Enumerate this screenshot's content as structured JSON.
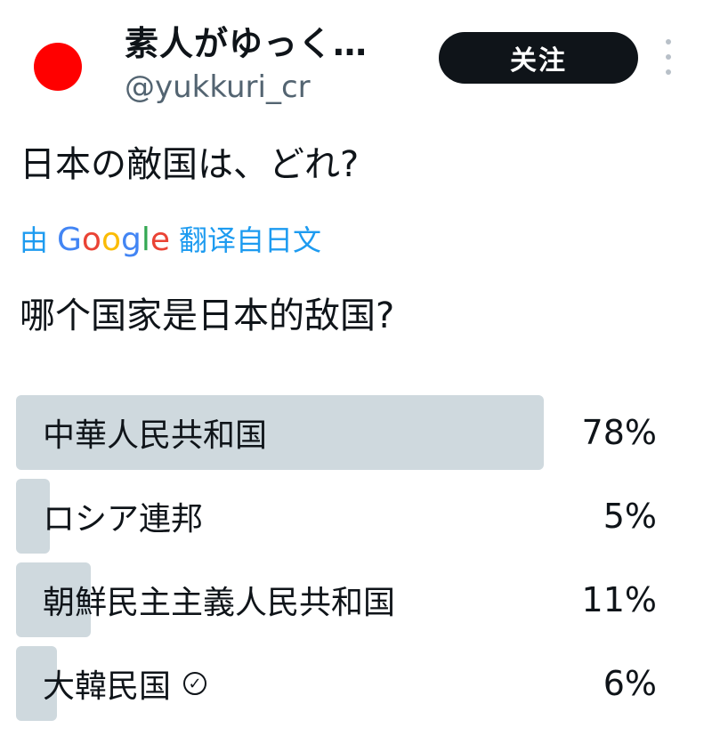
{
  "header": {
    "display_name": "素人がゆっく…",
    "handle": "@yukkuri_cr",
    "follow_label": "关注",
    "avatar_color": "#ff0000"
  },
  "tweet": {
    "text": "日本の敵国は、どれ?",
    "translate_prefix": "由",
    "translate_brand": "Google",
    "translate_suffix": "翻译自日文",
    "translated_text": "哪个国家是日本的敌国?"
  },
  "poll": {
    "options": [
      {
        "label": "中華人民共和国",
        "percent_label": "78%",
        "percent": 78
      },
      {
        "label": "ロシア連邦",
        "percent_label": "5%",
        "percent": 5
      },
      {
        "label": "朝鮮民主主義人民共和国",
        "percent_label": "11%",
        "percent": 11
      },
      {
        "label": "大韓民国",
        "percent_label": "6%",
        "percent": 6,
        "selected_icon": "check-circle-icon"
      }
    ]
  },
  "colors": {
    "accent": "#1d9bf0",
    "bar": "#cfd9de",
    "button": "#0f1419"
  }
}
